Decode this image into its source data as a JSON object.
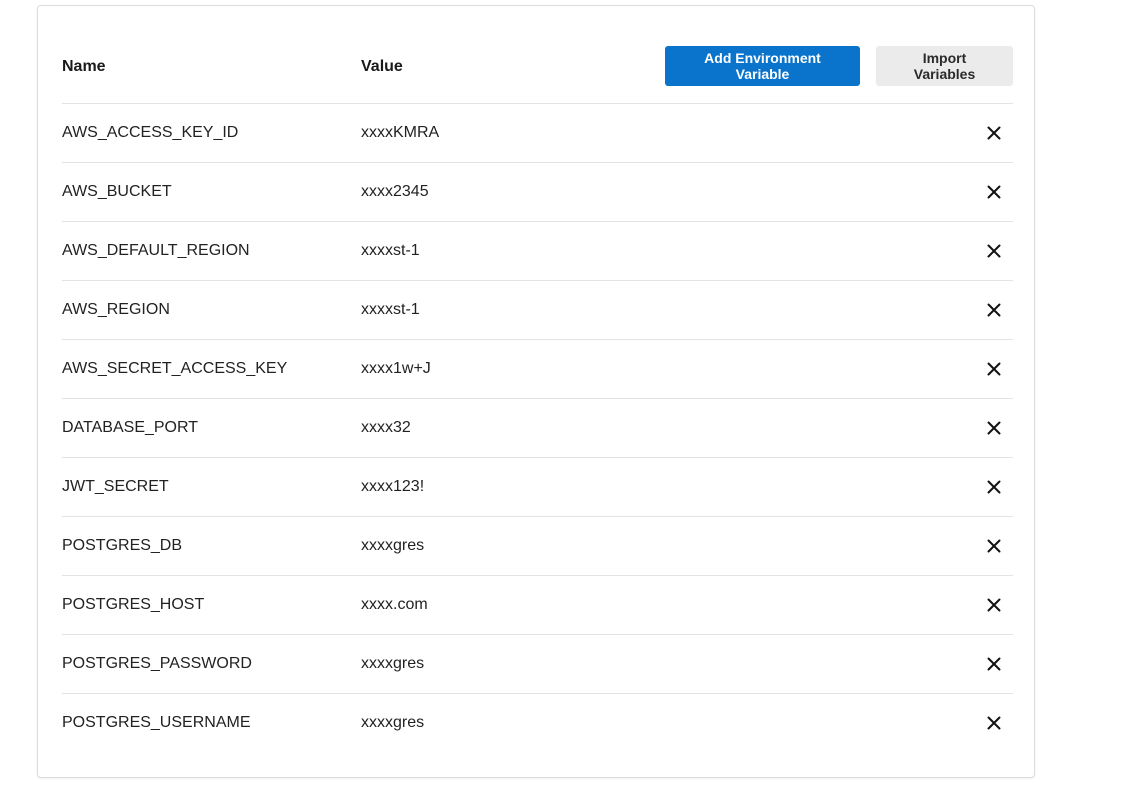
{
  "table": {
    "headers": {
      "name": "Name",
      "value": "Value"
    },
    "actions": {
      "add_label": "Add Environment Variable",
      "import_label": "Import Variables"
    },
    "rows": [
      {
        "name": "AWS_ACCESS_KEY_ID",
        "value": "xxxxKMRA"
      },
      {
        "name": "AWS_BUCKET",
        "value": "xxxx2345"
      },
      {
        "name": "AWS_DEFAULT_REGION",
        "value": "xxxxst-1"
      },
      {
        "name": "AWS_REGION",
        "value": "xxxxst-1"
      },
      {
        "name": "AWS_SECRET_ACCESS_KEY",
        "value": "xxxx1w+J"
      },
      {
        "name": "DATABASE_PORT",
        "value": "xxxx32"
      },
      {
        "name": "JWT_SECRET",
        "value": "xxxx123!"
      },
      {
        "name": "POSTGRES_DB",
        "value": "xxxxgres"
      },
      {
        "name": "POSTGRES_HOST",
        "value": "xxxx.com"
      },
      {
        "name": "POSTGRES_PASSWORD",
        "value": "xxxxgres"
      },
      {
        "name": "POSTGRES_USERNAME",
        "value": "xxxxgres"
      }
    ],
    "row_action_icon": "close-icon"
  },
  "colors": {
    "primary": "#0a74cc",
    "secondary_bg": "#ebebeb",
    "divider": "#e3e3e3",
    "border": "#dcdcdc"
  }
}
